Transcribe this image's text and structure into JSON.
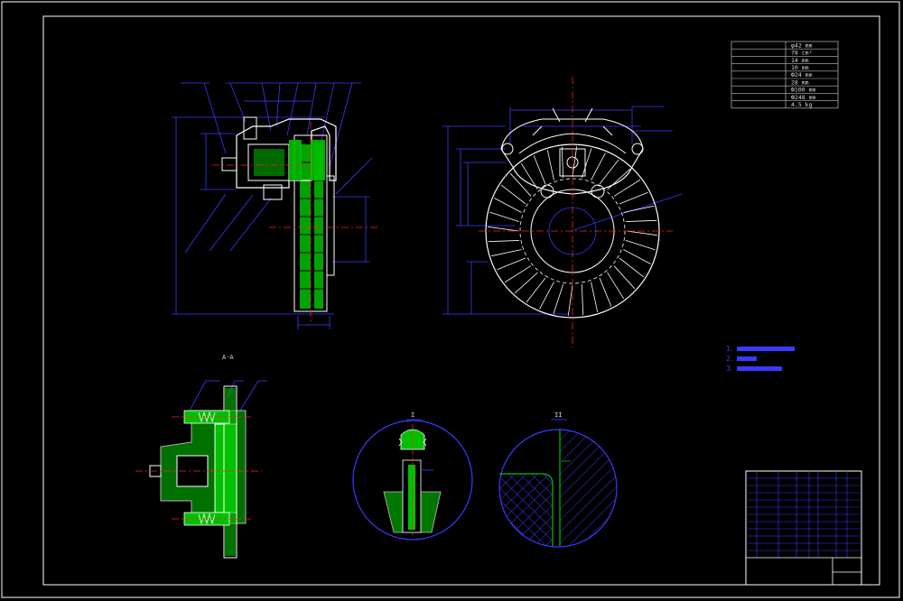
{
  "colors": {
    "background": "#000000",
    "frame": "#ffffff",
    "outline": "#ffffff",
    "dimension": "#3a3aff",
    "centerline": "#ff2020",
    "section_fill": "#00c000",
    "title_block": "#3a3aff"
  },
  "param_table": {
    "title": "",
    "rows": [
      {
        "label": "",
        "value": "φ42 mm"
      },
      {
        "label": "",
        "value": "78 cm²"
      },
      {
        "label": "",
        "value": "14 mm"
      },
      {
        "label": "",
        "value": "10 mm"
      },
      {
        "label": "",
        "value": "Ф24 mm"
      },
      {
        "label": "",
        "value": "28 mm"
      },
      {
        "label": "",
        "value": "Ф100 mm"
      },
      {
        "label": "",
        "value": "Ф248 mm"
      },
      {
        "label": "",
        "value": "4.5 kg"
      }
    ]
  },
  "tech_notes": {
    "heading": "",
    "items": [
      "1.",
      "2.",
      "3."
    ]
  },
  "view_labels": {
    "section_aa": "A-A",
    "detail_1": "I",
    "detail_2": "II"
  },
  "title_block": {
    "drawing_name": "",
    "drawing_number": ""
  }
}
